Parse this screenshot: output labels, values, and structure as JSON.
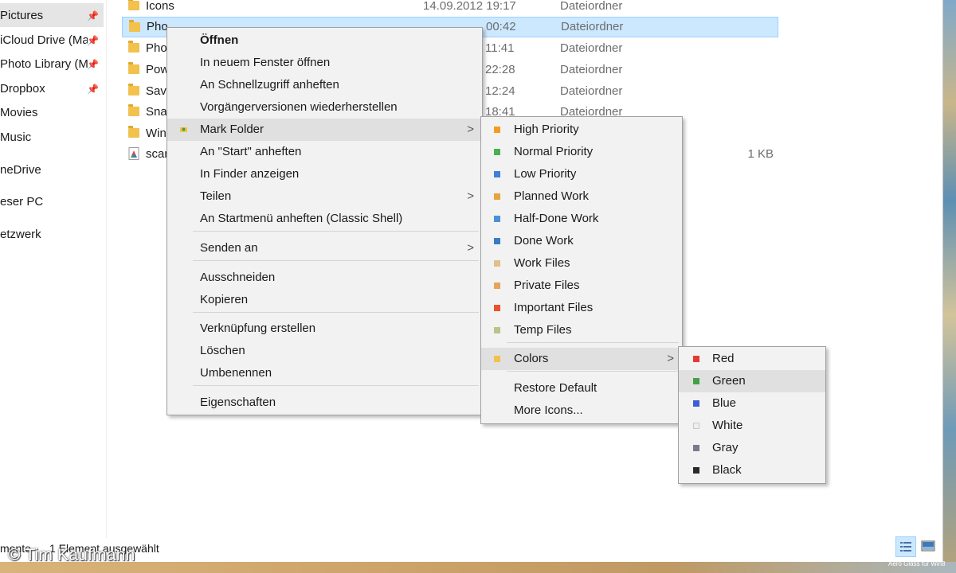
{
  "navigation": {
    "items": [
      {
        "label": "Pictures",
        "pinned": true
      },
      {
        "label": "iCloud Drive (Ma",
        "pinned": true
      },
      {
        "label": "Photo Library (M",
        "pinned": true
      },
      {
        "label": "Dropbox",
        "pinned": true
      },
      {
        "label": "Movies",
        "pinned": false
      },
      {
        "label": "Music",
        "pinned": false
      },
      {
        "label": "neDrive",
        "pinned": false
      },
      {
        "label": "eser PC",
        "pinned": false
      },
      {
        "label": "etzwerk",
        "pinned": false
      }
    ]
  },
  "files": [
    {
      "name": "Icons",
      "date": "14.09.2012 19:17",
      "type": "Dateiordner",
      "size": ""
    },
    {
      "name": "Pho",
      "date": "00:42",
      "type": "Dateiordner",
      "size": ""
    },
    {
      "name": "Pho",
      "date": "11:41",
      "type": "Dateiordner",
      "size": ""
    },
    {
      "name": "Pow",
      "date": "22:28",
      "type": "Dateiordner",
      "size": ""
    },
    {
      "name": "Save",
      "date": "12:24",
      "type": "Dateiordner",
      "size": ""
    },
    {
      "name": "Snap",
      "date": "18:41",
      "type": "Dateiordner",
      "size": ""
    },
    {
      "name": "Win",
      "date": "",
      "type": "",
      "size": ""
    },
    {
      "name": "scan",
      "date": "",
      "type": "",
      "size": "1 KB"
    }
  ],
  "context_menu": {
    "items": [
      {
        "label": "Öffnen",
        "bold": true
      },
      {
        "label": "In neuem Fenster öffnen"
      },
      {
        "label": "An Schnellzugriff anheften"
      },
      {
        "label": "Vorgängerversionen wiederherstellen"
      },
      {
        "label": "Mark Folder",
        "submenu": true,
        "icon": "mark-folder-icon"
      },
      {
        "label": "An \"Start\" anheften"
      },
      {
        "label": "In Finder anzeigen"
      },
      {
        "label": "Teilen",
        "submenu": true
      },
      {
        "label": "An Startmenü anheften (Classic Shell)"
      },
      {
        "label": "Senden an",
        "submenu": true
      },
      {
        "label": "Ausschneiden"
      },
      {
        "label": "Kopieren"
      },
      {
        "label": "Verknüpfung erstellen"
      },
      {
        "label": "Löschen"
      },
      {
        "label": "Umbenennen"
      },
      {
        "label": "Eigenschaften"
      }
    ]
  },
  "mark_folder_menu": {
    "items": [
      {
        "label": "High Priority",
        "color": "#f59a23"
      },
      {
        "label": "Normal Priority",
        "color": "#4caf50"
      },
      {
        "label": "Low Priority",
        "color": "#3f7fd8"
      },
      {
        "label": "Planned Work",
        "color": "#e8a33c"
      },
      {
        "label": "Half-Done Work",
        "color": "#4a90d9"
      },
      {
        "label": "Done Work",
        "color": "#3b7cc4"
      },
      {
        "label": "Work Files",
        "color": "#e2c08a"
      },
      {
        "label": "Private Files",
        "color": "#e6a35a"
      },
      {
        "label": "Important Files",
        "color": "#e8532e"
      },
      {
        "label": "Temp Files",
        "color": "#b8c48a"
      },
      {
        "label": "Colors",
        "submenu": true,
        "color": "#f2c14e"
      },
      {
        "label": "Restore Default"
      },
      {
        "label": "More Icons..."
      }
    ]
  },
  "colors_menu": {
    "items": [
      {
        "label": "Red",
        "color": "#e53935"
      },
      {
        "label": "Green",
        "color": "#43a047"
      },
      {
        "label": "Blue",
        "color": "#3b5fd6"
      },
      {
        "label": "White",
        "color": "#eeeeee"
      },
      {
        "label": "Gray",
        "color": "#7a7a8a"
      },
      {
        "label": "Black",
        "color": "#2a2a2a"
      }
    ]
  },
  "status_bar": {
    "count_text": "mente",
    "selected_text": "1 Element ausgewählt"
  },
  "watermark": "© Tim Kaufmann",
  "corner_text": "Aero Glass für Win8"
}
